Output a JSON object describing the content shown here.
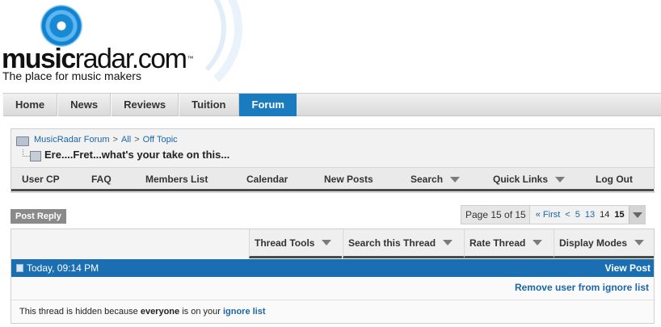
{
  "brand": {
    "logo_bold": "music",
    "logo_light": "radar.com",
    "logo_tm": "™",
    "tagline": "The place for music makers",
    "accent": "#1a7cbf"
  },
  "main_nav": {
    "items": [
      "Home",
      "News",
      "Reviews",
      "Tuition",
      "Forum"
    ],
    "active": "Forum"
  },
  "breadcrumb": {
    "items": [
      "MusicRadar Forum",
      "All",
      "Off Topic"
    ],
    "separator": ">",
    "thread_title": "Ere....Fret...what's your take on this..."
  },
  "sub_nav": {
    "user_cp": "User CP",
    "faq": "FAQ",
    "members": "Members List",
    "calendar": "Calendar",
    "new_posts": "New Posts",
    "search": "Search",
    "quick_links": "Quick Links",
    "logout": "Log Out"
  },
  "actions": {
    "post_reply": "Post Reply"
  },
  "pagination": {
    "label": "Page 15 of 15",
    "first": "« First",
    "prev": "<",
    "pages": [
      "5",
      "13",
      "14",
      "15"
    ],
    "current": "15"
  },
  "thread_tools": {
    "thread_tools": "Thread Tools",
    "search_thread": "Search this Thread",
    "rate_thread": "Rate Thread",
    "display_modes": "Display Modes"
  },
  "post": {
    "date": "Today, 09:14 PM",
    "view_post": "View Post",
    "remove_ignore": "Remove user from ignore list",
    "hidden_prefix": "This thread is hidden because ",
    "hidden_who": "everyone",
    "hidden_mid": " is on your ",
    "hidden_link": "ignore list"
  }
}
